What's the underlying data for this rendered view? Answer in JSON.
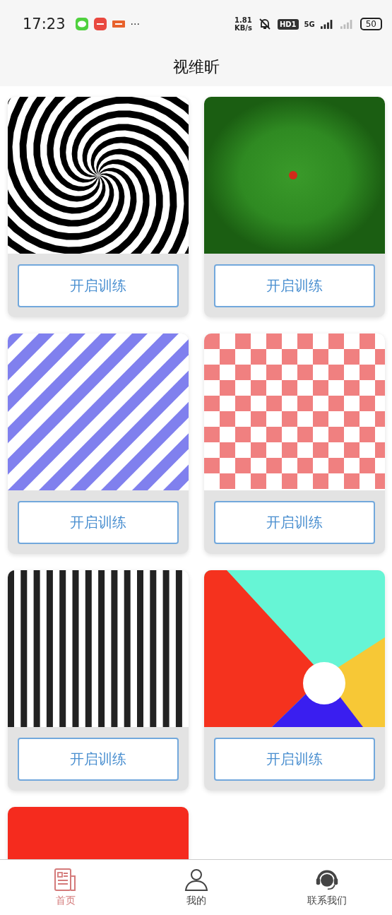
{
  "status_bar": {
    "time": "17:23",
    "more": "···",
    "speed_value": "1.81",
    "speed_unit": "KB/s",
    "hd": "HD1",
    "network": "5G",
    "battery": "50"
  },
  "header": {
    "title": "视维昕"
  },
  "cards": [
    {
      "kind": "picture",
      "button": "开启训练"
    },
    {
      "kind": "picture",
      "button": "开启训练"
    },
    {
      "kind": "picture",
      "button": "开启训练"
    },
    {
      "kind": "picture",
      "button": "开启训练"
    },
    {
      "kind": "picture",
      "button": "开启训练"
    },
    {
      "kind": "picture",
      "button": "开启训练"
    },
    {
      "kind": "picture"
    }
  ],
  "tab_bar": [
    {
      "label": "首页",
      "selected": true
    },
    {
      "label": "我的",
      "selected": false
    },
    {
      "label": "联系我们",
      "selected": false
    }
  ]
}
